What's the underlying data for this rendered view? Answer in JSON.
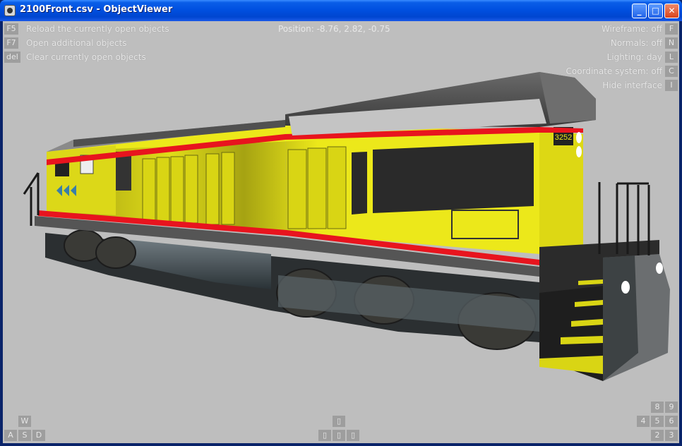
{
  "window": {
    "title": "2100Front.csv - ObjectViewer",
    "min": "_",
    "max": "□",
    "close": "✕"
  },
  "left_commands": [
    {
      "key": "F5",
      "label": "Reload the currently open objects"
    },
    {
      "key": "F7",
      "label": "Open additional objects"
    },
    {
      "key": "del",
      "label": "Clear currently open objects"
    }
  ],
  "position": "Position: -8.76, 2.82, -0.75",
  "right_options": [
    {
      "label": "Wireframe: off",
      "key": "F"
    },
    {
      "label": "Normals: off",
      "key": "N"
    },
    {
      "label": "Lighting: day",
      "key": "L"
    },
    {
      "label": "Coordinate system: off",
      "key": "C"
    },
    {
      "label": "Hide interface",
      "key": "I"
    }
  ],
  "move_keys": {
    "up": "W",
    "left": "A",
    "down": "S",
    "right": "D"
  },
  "arrow_keys": {
    "up": "▯",
    "left": "▯",
    "down": "▯",
    "right": "▯"
  },
  "numpad": {
    "k8": "8",
    "k9": "9",
    "k4": "4",
    "k5": "5",
    "k6": "6",
    "k2": "2",
    "k3": "3"
  },
  "locomotive": {
    "number": "3252",
    "body_color": "#ece81a",
    "stripe_color": "#e8141e",
    "roof_color": "#8a8a8a"
  }
}
